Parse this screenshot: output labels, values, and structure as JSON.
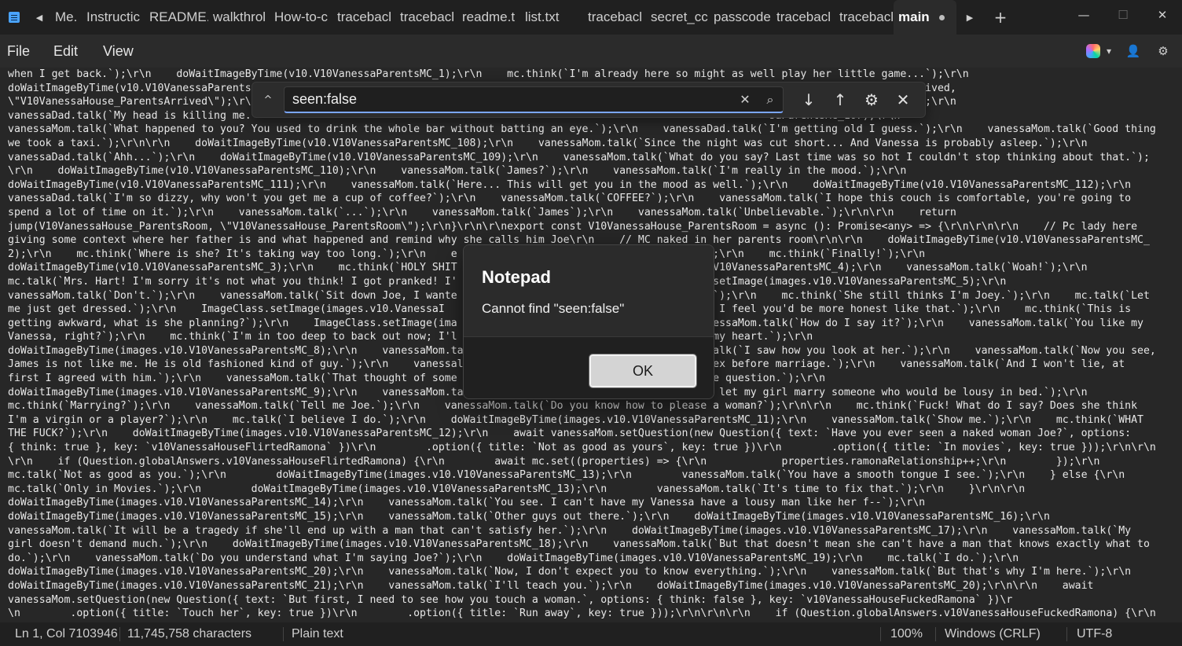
{
  "titlebar": {
    "tabs": [
      {
        "label": "Me."
      },
      {
        "label": "Instructic"
      },
      {
        "label": "README."
      },
      {
        "label": "walkthrol"
      },
      {
        "label": "How-to-c"
      },
      {
        "label": "tracebacl"
      },
      {
        "label": "tracebacl"
      },
      {
        "label": "readme.t"
      },
      {
        "label": "list.txt"
      },
      {
        "label": "tracebacl"
      },
      {
        "label": "secret_cc"
      },
      {
        "label": "passcode"
      },
      {
        "label": "tracebacl"
      },
      {
        "label": "tracebacl"
      }
    ],
    "active_tab": "main",
    "new_tab": "+",
    "scroll_left": "◀",
    "scroll_right": "▶",
    "minimize": "—",
    "maximize": "☐",
    "close": "✕"
  },
  "menu": {
    "file": "File",
    "edit": "Edit",
    "view": "View"
  },
  "icons": {
    "copilot": "copilot-icon",
    "account": "account-icon",
    "settings": "gear-icon"
  },
  "editor": {
    "lines": [
      "when I get back.`);\\r\\n    doWaitImageByTime(v10.V10VanessaParentsMC_1);\\r\\n    mc.think(`I'm already here so might as well play her little game...`);\\r\\n",
      "doWaitImageByTime(v10.V10VanessaParents                                                                                   .0VanessaHouse_ParentsArrived,",
      "\\\"V10VanessaHouse_ParentsArrived\\\");\\r\\                                                                                 .0.V10VanessaParentsMC_106);\\r\\n",
      "vanessaDad.talk(`My head is killing me.                                                                                   saParentsMC_107);\\r\\n",
      "vanessaMom.talk(`What happened to you? You used to drink the whole bar without batting an eye.`);\\r\\n    vanessaDad.talk(`I'm getting old I guess.`);\\r\\n    vanessaMom.talk(`Good thing",
      "we took a taxi.`);\\r\\n\\r\\n    doWaitImageByTime(v10.V10VanessaParentsMC_108);\\r\\n    vanessaMom.talk(`Since the night was cut short... And Vanessa is probably asleep.`);\\r\\n",
      "vanessaDad.talk(`Ahh...`);\\r\\n    doWaitImageByTime(v10.V10VanessaParentsMC_109);\\r\\n    vanessaMom.talk(`What do you say? Last time was so hot I couldn't stop thinking about that.`);",
      "\\r\\n    doWaitImageByTime(v10.V10VanessaParentsMC_110);\\r\\n    vanessaMom.talk(`James?`);\\r\\n    vanessaMom.talk(`I'm really in the mood.`);\\r\\n",
      "doWaitImageByTime(v10.V10VanessaParentsMC_111);\\r\\n    vanessaMom.talk(`Here... This will get you in the mood as well.`);\\r\\n    doWaitImageByTime(v10.V10VanessaParentsMC_112);\\r\\n",
      "vanessaDad.talk(`I'm so dizzy, why won't you get me a cup of coffee?`);\\r\\n    vanessaMom.talk(`COFFEE?`);\\r\\n    vanessaMom.talk(`I hope this couch is comfortable, you're going to",
      "spend a lot of time on it.`);\\r\\n    vanessaMom.talk(`...`);\\r\\n    vanessaMom.talk(`James`);\\r\\n    vanessaMom.talk(`Unbelievable.`);\\r\\n\\r\\n    return",
      "jump(V10VanessaHouse_ParentsRoom, \\\"V10VanessaHouse_ParentsRoom\\\");\\r\\n}\\r\\n\\r\\nexport const V10VanessaHouse_ParentsRoom = async (): Promise<any> => {\\r\\n\\r\\n\\r\\n    // Pc lady here",
      "giving some context where her father is and what happened and remind why she calls him Joe\\r\\n    // MC naked in her parents room\\r\\n\\r\\n    doWaitImageByTime(v10.V10VanessaParentsMC_",
      "2);\\r\\n    mc.think(`Where is she? It's taking way too long.`);\\r\\n    e                                       `);\\r\\n    mc.think(`Finally!`);\\r\\n",
      "doWaitImageByTime(v10.V10VanessaParentsMC_3);\\r\\n    mc.think(`HOLY SHIT                                       s.V10VanessaParentsMC_4);\\r\\n    vanessaMom.talk(`Woah!`);\\r\\n",
      "mc.talk(`Mrs. Hart! I'm sorry it's not what you think! I got pranked! I'                                       s.setImage(images.v10.V10VanessaParentsMC_5);\\r\\n",
      "vanessaMom.talk(`Don't.`);\\r\\n    vanessaMom.talk(`Sit down Joe, I wante                                       e.`);\\r\\n    mc.think(`She still thinks I'm Joey.`);\\r\\n    mc.talk(`Let",
      "me just get dressed.`);\\r\\n    ImageClass.setImage(images.v10.VanessaI                                       n't. I feel you'd be more honest like that.`);\\r\\n    mc.think(`This is",
      "getting awkward, what is she planning?`);\\r\\n    ImageClass.setImage(ima                                       anessaMom.talk(`How do I say it?`);\\r\\n    vanessaMom.talk(`You like my",
      "Vanessa, right?`);\\r\\n    mc.think(`I'm in too deep to back out now; I'l                                       l my heart.`);\\r\\n",
      "doWaitImageByTime(images.v10.V10VanessaParentsMC_8);\\r\\n    vanessaMom.ta                                       talk(`I saw how you look at her.`);\\r\\n    vanessaMom.talk(`Now you see,",
      "James is not like me. He is old fashioned kind of guy.`);\\r\\n    vanessal                                       sex before marriage.`);\\r\\n    vanessaMom.talk(`And I won't lie, at",
      "first I agreed with him.`);\\r\\n    vanessaMom.talk(`That thought of some                                       the question.`);\\r\\n",
      "doWaitImageByTime(images.v10.V10VanessaParentsMC_9);\\r\\n    vanessaMom.ta                                       I let my girl marry someone who would be lousy in bed.`);\\r\\n",
      "mc.think(`Marrying?`);\\r\\n    vanessaMom.talk(`Tell me Joe.`);\\r\\n    vanessaMom.talk(`Do you know how to please a woman?`);\\r\\n\\r\\n    mc.think(`Fuck! What do I say? Does she think",
      "I'm a virgin or a player?`);\\r\\n    mc.talk(`I believe I do.`);\\r\\n    doWaitImageByTime(images.v10.V10VanessaParentsMC_11);\\r\\n    vanessaMom.talk(`Show me.`);\\r\\n    mc.think(`WHAT",
      "THE FUCK?`);\\r\\n    doWaitImageByTime(images.v10.V10VanessaParentsMC_12);\\r\\n    await vanessaMom.setQuestion(new Question({ text: `Have you ever seen a naked woman Joe?`, options:",
      "{ think: true }, key: `v10VanessaHouseFlirtedRamona` })\\r\\n        .option({ title: `Not as good as yours`, key: true })\\r\\n        .option({ title: `In movies`, key: true }));\\r\\n\\r\\n",
      "\\r\\n    if (Question.globalAnswers.v10VanessaHouseFlirtedRamona) {\\r\\n        await mc.set((properties) => {\\r\\n            properties.ramonaRelationship++;\\r\\n        });\\r\\n",
      "mc.talk(`Not as good as you.`);\\r\\n        doWaitImageByTime(images.v10.V10VanessaParentsMC_13);\\r\\n        vanessaMom.talk(`You have a smooth tongue I see.`);\\r\\n    } else {\\r\\n",
      "mc.talk(`Only in Movies.`);\\r\\n        doWaitImageByTime(images.v10.V10VanessaParentsMC_13);\\r\\n        vanessaMom.talk(`It's time to fix that.`);\\r\\n    }\\r\\n\\r\\n",
      "doWaitImageByTime(images.v10.V10VanessaParentsMC_14);\\r\\n    vanessaMom.talk(`You see. I can't have my Vanessa have a lousy man like her f--`);\\r\\n",
      "doWaitImageByTime(images.v10.V10VanessaParentsMC_15);\\r\\n    vanessaMom.talk(`Other guys out there.`);\\r\\n    doWaitImageByTime(images.v10.V10VanessaParentsMC_16);\\r\\n",
      "vanessaMom.talk(`It will be a tragedy if she'll end up with a man that can't satisfy her.`);\\r\\n    doWaitImageByTime(images.v10.V10VanessaParentsMC_17);\\r\\n    vanessaMom.talk(`My",
      "girl doesn't demand much.`);\\r\\n    doWaitImageByTime(images.v10.V10VanessaParentsMC_18);\\r\\n    vanessaMom.talk(`But that doesn't mean she can't have a man that knows exactly what to",
      "do.`);\\r\\n    vanessaMom.talk(`Do you understand what I'm saying Joe?`);\\r\\n    doWaitImageByTime(images.v10.V10VanessaParentsMC_19);\\r\\n    mc.talk(`I do.`);\\r\\n",
      "doWaitImageByTime(images.v10.V10VanessaParentsMC_20);\\r\\n    vanessaMom.talk(`Now, I don't expect you to know everything.`);\\r\\n    vanessaMom.talk(`But that's why I'm here.`);\\r\\n",
      "doWaitImageByTime(images.v10.V10VanessaParentsMC_21);\\r\\n    vanessaMom.talk(`I'll teach you.`);\\r\\n    doWaitImageByTime(images.v10.V10VanessaParentsMC_20);\\r\\n\\r\\n    await",
      "vanessaMom.setQuestion(new Question({ text: `But first, I need to see how you touch a woman.`, options: { think: false }, key: `v10VanessaHouseFuckedRamona` })\\r",
      "\\n        .option({ title: `Touch her`, key: true })\\r\\n        .option({ title: `Run away`, key: true }));\\r\\n\\r\\n\\r\\n    if (Question.globalAnswers.v10VanessaHouseFuckedRamona) {\\r\\n"
    ]
  },
  "find": {
    "toggle": "^",
    "query": "seen:false",
    "clear": "✕",
    "search": "⌕",
    "next": "↓",
    "previous": "↑",
    "options": "⚙",
    "close": "✕"
  },
  "dialog": {
    "title": "Notepad",
    "message": "Cannot find \"seen:false\"",
    "ok": "OK"
  },
  "status": {
    "position": "Ln 1, Col 7103946",
    "characters": "11,745,758 characters",
    "format": "Plain text",
    "zoom": "100%",
    "line_ending": "Windows (CRLF)",
    "encoding": "UTF-8"
  }
}
